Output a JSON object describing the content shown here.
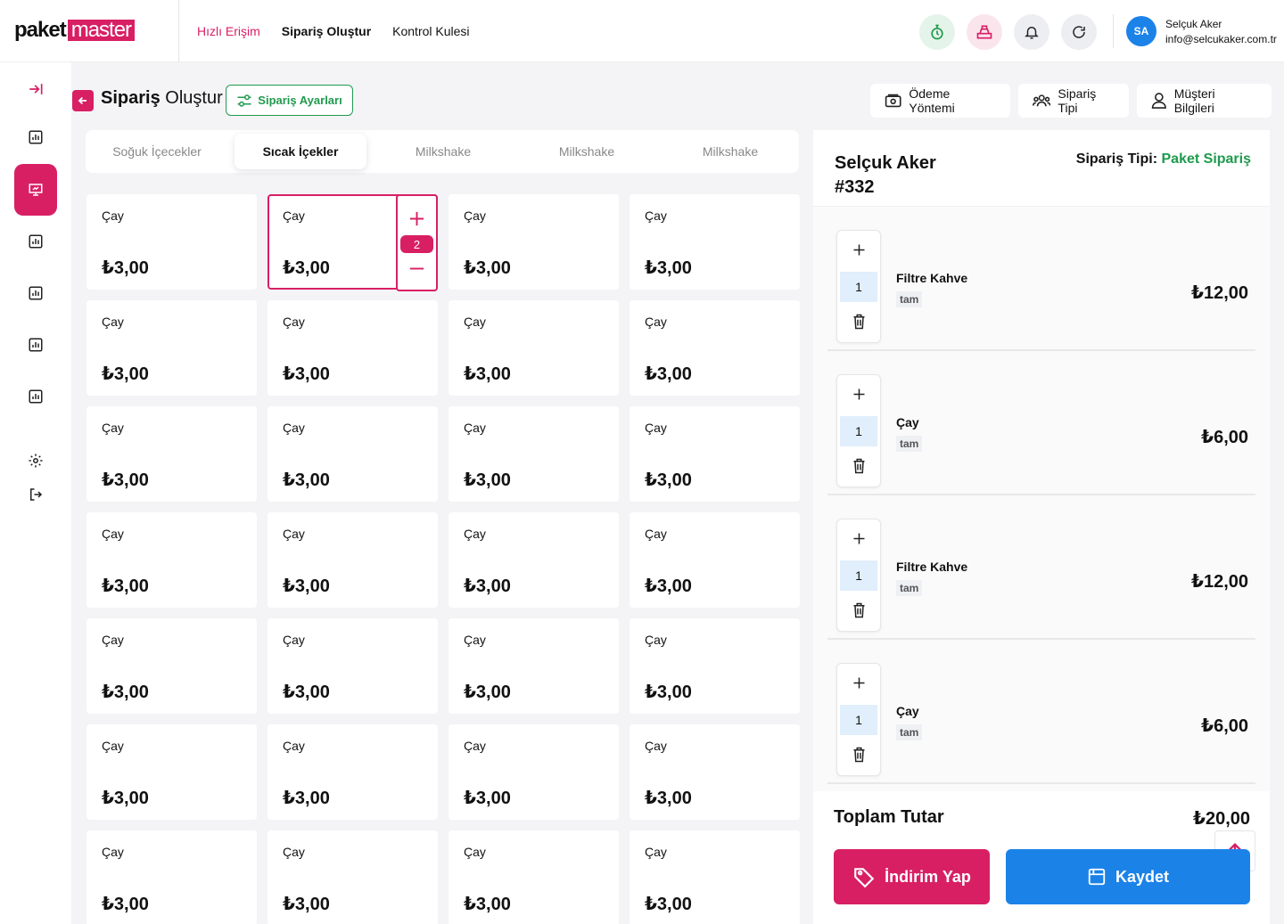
{
  "logo": {
    "part1": "paket",
    "part2": "master"
  },
  "nav": {
    "quick_access": "Hızlı Erişim",
    "create_order": "Sipariş Oluştur",
    "control_tower": "Kontrol Kulesi"
  },
  "user": {
    "initials": "SA",
    "name": "Selçuk Aker",
    "email": "info@selcukaker.com.tr"
  },
  "header": {
    "title_bold": "Sipariş",
    "title_rest": " Oluştur",
    "settings_label": "Sipariş Ayarları",
    "payment_method": "Ödeme Yöntemi",
    "order_type": "Sipariş Tipi",
    "customer_info": "Müşteri Bilgileri"
  },
  "tabs": [
    "Soğuk İçecekler",
    "Sıcak İçekler",
    "Milkshake",
    "Milkshake",
    "Milkshake"
  ],
  "products": [
    {
      "name": "Çay",
      "price": "₺3,00"
    },
    {
      "name": "Çay",
      "price": "₺3,00"
    },
    {
      "name": "Çay",
      "price": "₺3,00"
    },
    {
      "name": "Çay",
      "price": "₺3,00"
    },
    {
      "name": "Çay",
      "price": "₺3,00"
    },
    {
      "name": "Çay",
      "price": "₺3,00"
    },
    {
      "name": "Çay",
      "price": "₺3,00"
    },
    {
      "name": "Çay",
      "price": "₺3,00"
    },
    {
      "name": "Çay",
      "price": "₺3,00"
    },
    {
      "name": "Çay",
      "price": "₺3,00"
    },
    {
      "name": "Çay",
      "price": "₺3,00"
    },
    {
      "name": "Çay",
      "price": "₺3,00"
    },
    {
      "name": "Çay",
      "price": "₺3,00"
    },
    {
      "name": "Çay",
      "price": "₺3,00"
    },
    {
      "name": "Çay",
      "price": "₺3,00"
    },
    {
      "name": "Çay",
      "price": "₺3,00"
    },
    {
      "name": "Çay",
      "price": "₺3,00"
    },
    {
      "name": "Çay",
      "price": "₺3,00"
    },
    {
      "name": "Çay",
      "price": "₺3,00"
    },
    {
      "name": "Çay",
      "price": "₺3,00"
    },
    {
      "name": "Çay",
      "price": "₺3,00"
    },
    {
      "name": "Çay",
      "price": "₺3,00"
    },
    {
      "name": "Çay",
      "price": "₺3,00"
    },
    {
      "name": "Çay",
      "price": "₺3,00"
    },
    {
      "name": "Çay",
      "price": "₺3,00"
    },
    {
      "name": "Çay",
      "price": "₺3,00"
    },
    {
      "name": "Çay",
      "price": "₺3,00"
    },
    {
      "name": "Çay",
      "price": "₺3,00"
    }
  ],
  "selected_product_qty": "2",
  "cart": {
    "customer": "Selçuk Aker",
    "order_no": "#332",
    "order_type_label": "Sipariş Tipi:",
    "order_type_value": "Paket Sipariş",
    "items": [
      {
        "qty": "1",
        "name": "Filtre Kahve",
        "tag": "tam",
        "price": "₺12,00"
      },
      {
        "qty": "1",
        "name": "Çay",
        "tag": "tam",
        "price": "₺6,00"
      },
      {
        "qty": "1",
        "name": "Filtre Kahve",
        "tag": "tam",
        "price": "₺12,00"
      },
      {
        "qty": "1",
        "name": "Çay",
        "tag": "tam",
        "price": "₺6,00"
      }
    ],
    "total_label": "Toplam Tutar",
    "total_value": "₺20,00",
    "discount_label": "İndirim Yap",
    "save_label": "Kaydet"
  },
  "colors": {
    "brand": "#d81f64",
    "primary_blue": "#1b82e8",
    "green": "#1f9a4d"
  }
}
